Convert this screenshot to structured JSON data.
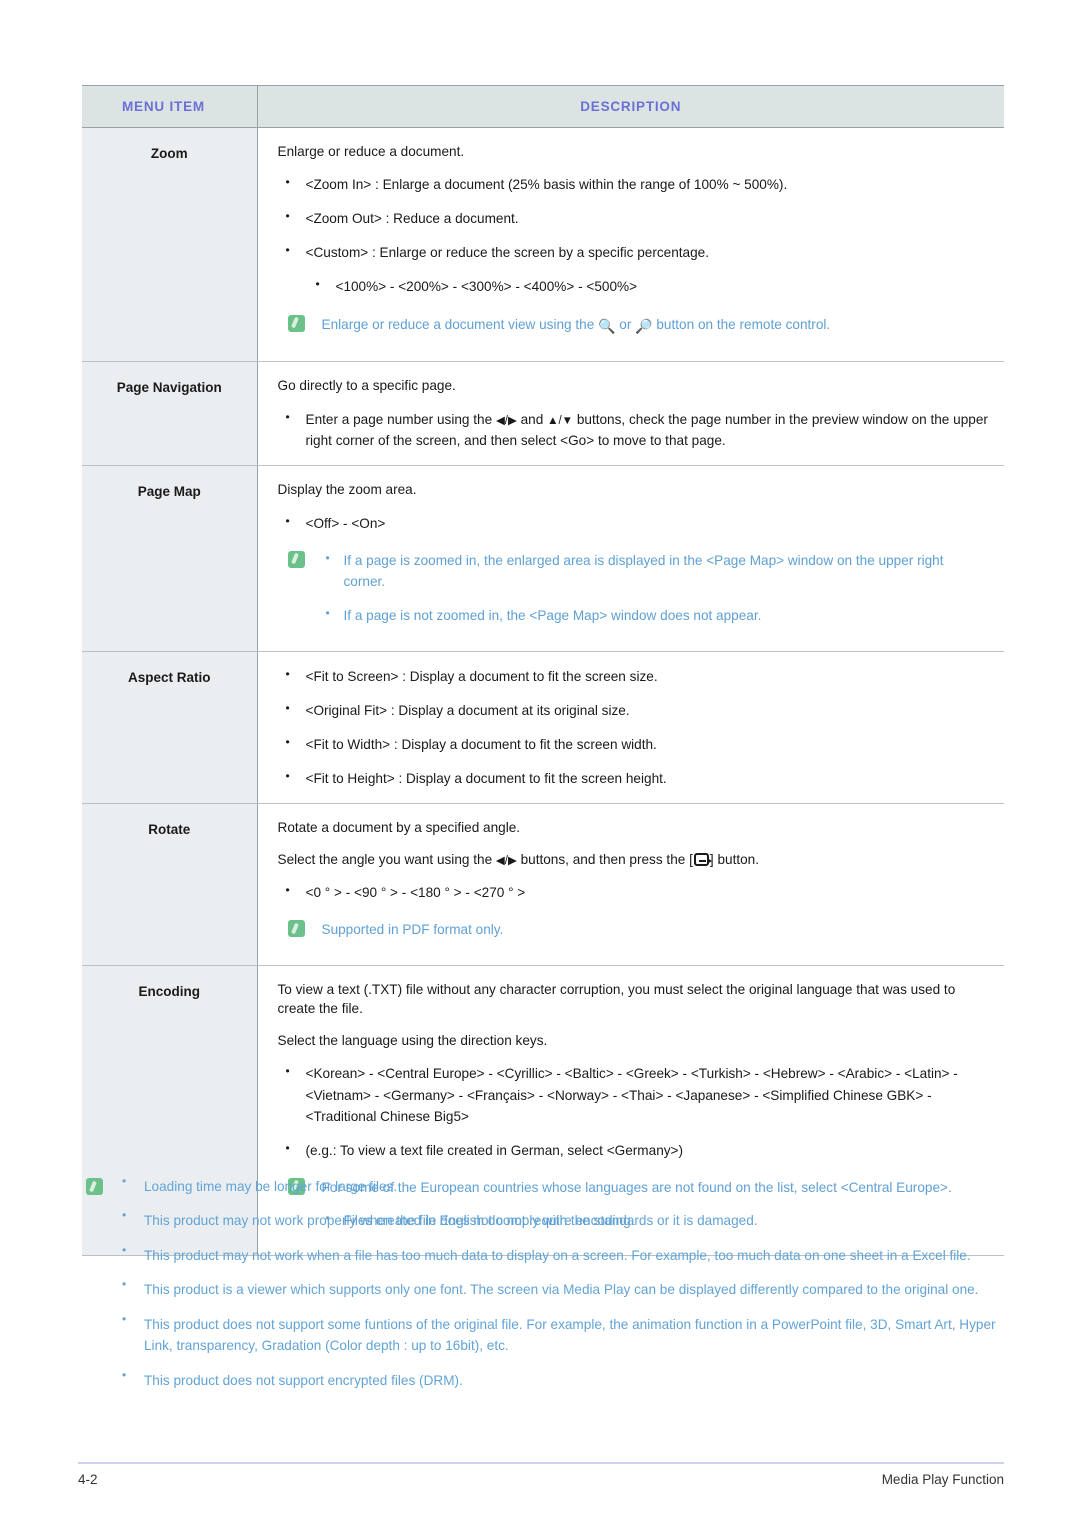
{
  "table": {
    "headers": {
      "menu_item": "MENU ITEM",
      "description": "DESCRIPTION"
    },
    "rows": [
      {
        "menu_item": "Zoom",
        "intro": "Enlarge or reduce a document.",
        "bullets": [
          "<Zoom In> : Enlarge a document (25% basis within the range of 100% ~ 500%).",
          "<Zoom Out> : Reduce a document.",
          "<Custom> : Enlarge or reduce the screen by a specific percentage."
        ],
        "sub_bullets": [
          "<100%> - <200%> - <300%> - <400%> - <500%>"
        ],
        "note_prefix": "Enlarge or reduce a document view using the ",
        "note_mid": " or ",
        "note_suffix": " button on the remote control."
      },
      {
        "menu_item": "Page Navigation",
        "intro": "Go directly to a specific page.",
        "bullet_pre": "Enter a page number using the ",
        "bullet_mid": " and ",
        "bullet_post": " buttons, check the page number in the preview window on the upper right corner of the screen, and then select <Go> to move to that page."
      },
      {
        "menu_item": "Page Map",
        "intro": "Display the zoom area.",
        "bullets": [
          "<Off> - <On>"
        ],
        "notes": [
          "If a page is zoomed in, the enlarged area is displayed in the <Page Map> window on the upper right corner.",
          "If a page is not zoomed in, the <Page Map> window does not appear."
        ]
      },
      {
        "menu_item": "Aspect Ratio",
        "bullets": [
          "<Fit to Screen> : Display a document to fit the screen size.",
          "<Original Fit> : Display a document at its original size.",
          "<Fit to Width> : Display a document to fit the screen width.",
          "<Fit to Height> : Display a document to fit the screen height."
        ]
      },
      {
        "menu_item": "Rotate",
        "intro": "Rotate a document by a specified angle.",
        "line2_pre": "Select the angle you want using the ",
        "line2_mid": " buttons, and then press the [",
        "line2_post": "] button.",
        "bullets": [
          "<0 ° > - <90 ° > - <180 ° > -  <270 ° >"
        ],
        "note": "Supported in PDF format only."
      },
      {
        "menu_item": "Encoding",
        "intro": "To view a text (.TXT) file without any character corruption, you must select the original language that was used to create the file.",
        "intro2": "Select the language using the direction keys.",
        "bullets": [
          "<Korean> - <Central Europe> - <Cyrillic> - <Baltic> - <Greek> - <Turkish> - <Hebrew> - <Arabic> - <Latin> - <Vietnam> - <Germany> - <Français> - <Norway> - <Thai> - <Japanese> - <Simplified Chinese GBK> - <Traditional Chinese Big5>"
        ],
        "example": "(e.g.: To view a text file created in German, select <Germany>)",
        "note": "For some of the European countries whose languages are not found on the list, select <Central Europe>.",
        "note_bullets": [
          "Files created in English do not require encoding."
        ]
      }
    ]
  },
  "footnotes": [
    "Loading time may be longer for large files.",
    "This product may not work properly when the file does not comply with the standards or it is damaged.",
    "This product may not work when a file has too much data to display on a screen. For example, too much data on one sheet in a Excel file.",
    "This product is a viewer which supports only one font. The screen via Media Play can be displayed differently compared to the original one.",
    "This product does not support some funtions of the original file. For example, the animation function in a PowerPoint file, 3D, Smart Art, Hyper Link, transparency, Gradation (Color depth : up to 16bit), etc.",
    "This product does not support encrypted files (DRM)."
  ],
  "footer": {
    "page_number": "4-2",
    "section_title": "Media Play Function"
  },
  "icons": {
    "note": "note-pencil-icon",
    "zoom_in": "⊕",
    "zoom_out": "⊖",
    "left_right": "◀/▶",
    "up_down": "▲/▼",
    "enter": "enter-key-icon"
  },
  "colors": {
    "header_bg": "#dce3e3",
    "header_text": "#6b70d6",
    "menu_col_bg": "#eaeef1",
    "note_blue": "#5fa0d4",
    "note_icon_green": "#6cc08a",
    "footer_rule": "#ccd0ee"
  }
}
